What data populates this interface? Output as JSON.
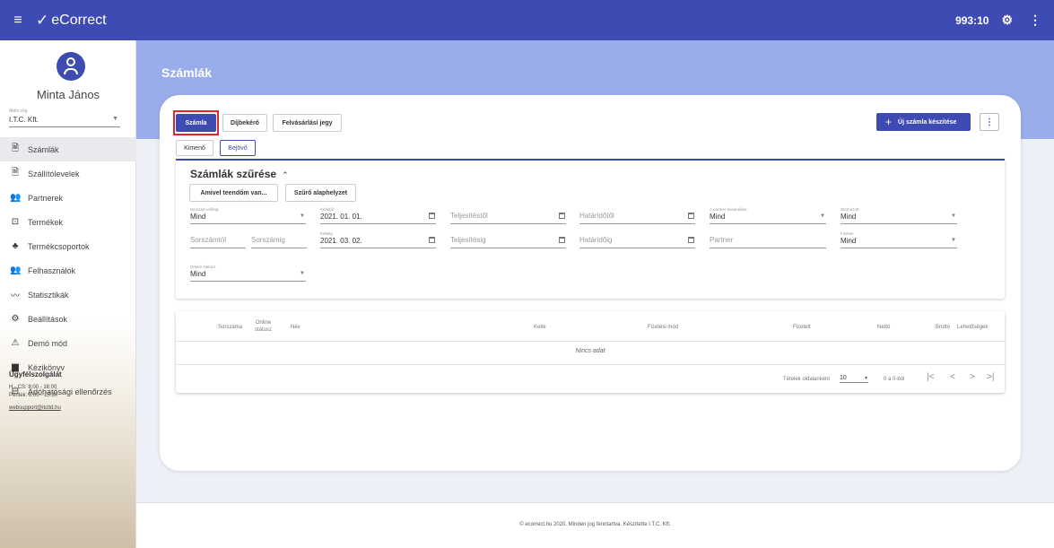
{
  "header": {
    "app_title": "eCorrect",
    "timer": "993:10"
  },
  "sidebar": {
    "user_name": "Minta János",
    "company_label": "Aktív cég",
    "company_value": "I.T.C. Kft.",
    "items": [
      {
        "label": "Számlák",
        "icon": "document-icon",
        "active": true
      },
      {
        "label": "Szállítólevelek",
        "icon": "document-icon",
        "active": false
      },
      {
        "label": "Partnerek",
        "icon": "people-icon",
        "active": false
      },
      {
        "label": "Termékek",
        "icon": "product-icon",
        "active": false
      },
      {
        "label": "Termékcsoportok",
        "icon": "group-icon",
        "active": false
      },
      {
        "label": "Felhasználók",
        "icon": "people-icon",
        "active": false
      },
      {
        "label": "Statisztikák",
        "icon": "chart-line-icon",
        "active": false
      },
      {
        "label": "Beállítások",
        "icon": "gear-icon",
        "active": false
      },
      {
        "label": "Demó mód",
        "icon": "warning-icon",
        "active": false
      },
      {
        "label": "Kézikönyv",
        "icon": "book-icon",
        "active": false
      },
      {
        "label": "Adóhatósági ellenőrzés",
        "icon": "tax-icon",
        "active": false
      }
    ],
    "support": {
      "title": "Ügyfélszolgálat",
      "hours_1": "H - CS: 8:00 - 16:00",
      "hours_2": "Péntek: 8:00 - 15:30",
      "email": "websupport@itcltd.hu"
    }
  },
  "main": {
    "page_title": "Számlák",
    "doc_types": [
      "Számla",
      "Díjbekérő",
      "Felvásárlási jegy"
    ],
    "direction_tabs": [
      "Kimenő",
      "Bejövő"
    ],
    "new_invoice_label": "Új számla készítése",
    "filter": {
      "title": "Számlák szűrése",
      "todo_button": "Amivel teendőm van...",
      "reset_button": "Szűrő alaphelyzet",
      "fields": {
        "serial_block": {
          "label": "Sorszám-előtag",
          "value": "Mind"
        },
        "date_from": {
          "label": "Keltétől",
          "value": "2021. 01. 01."
        },
        "fulfil_from": {
          "placeholder": "Teljesítéstől"
        },
        "due_from": {
          "placeholder": "Határidőtől"
        },
        "partner_class": {
          "label": "A partner besorolása",
          "value": "Mind"
        },
        "cancelled": {
          "label": "Stornózott",
          "value": "Mind"
        },
        "serial_from": {
          "placeholder": "Sorszámtól"
        },
        "serial_to": {
          "placeholder": "Sorszámig"
        },
        "date_to": {
          "label": "Keltéig",
          "value": "2021. 03. 02."
        },
        "fulfil_to": {
          "placeholder": "Teljesítésig"
        },
        "due_to": {
          "placeholder": "Határidőig"
        },
        "partner": {
          "placeholder": "Partner"
        },
        "paid": {
          "label": "Fizetve",
          "value": "Mind"
        },
        "online_status": {
          "label": "Online státusz",
          "value": "Mind"
        }
      }
    },
    "table": {
      "columns": [
        "Sorszáma",
        "Online\nstátusz",
        "Név",
        "Kelte",
        "Fizetési mód",
        "Fizetett",
        "Nettó",
        "Bruttó",
        "Lehetőségek"
      ],
      "empty_text": "Nincs adat",
      "per_page_label": "Tételek oldalanként",
      "per_page_value": "10",
      "range_text": "0 a 0-ból"
    }
  },
  "footer": {
    "text": "© ecorrect.hu 2020. Minden jog fenntartva. Készítette I.T.C. Kft."
  },
  "colors": {
    "primary": "#3e4bb2",
    "hero": "#9aadea",
    "highlight": "#e0242a"
  }
}
